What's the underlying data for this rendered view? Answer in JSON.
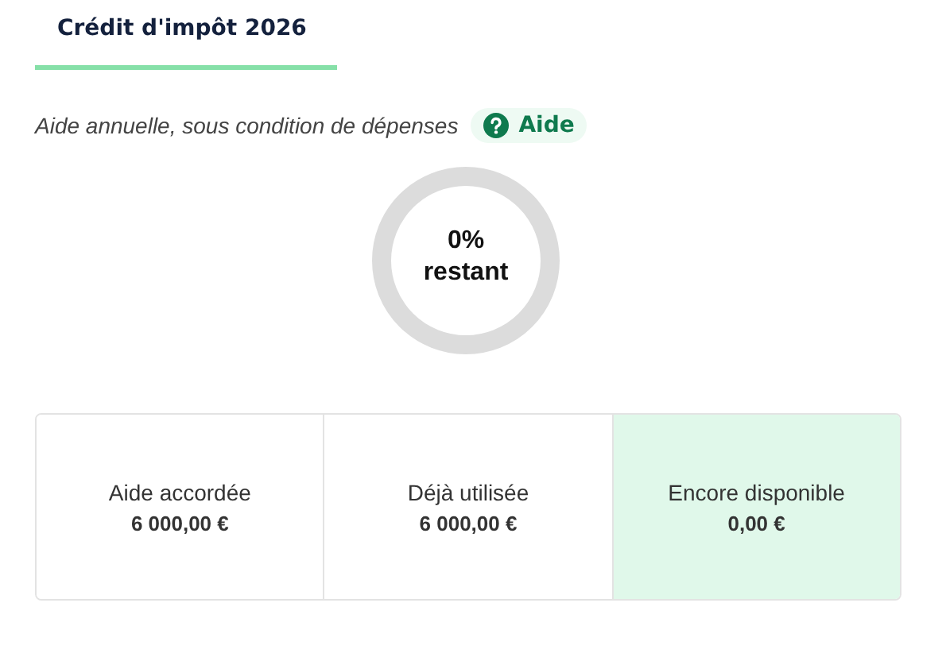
{
  "tabs": [
    {
      "label": "Crédit d'impôt 2026",
      "selected": true
    }
  ],
  "description": "Aide annuelle, sous condition de dépenses",
  "help_button": {
    "label": "Aide"
  },
  "gauge": {
    "value": "0%",
    "caption": "restant"
  },
  "summary": [
    {
      "label": "Aide accordée",
      "amount": "6 000,00 €",
      "highlighted": false
    },
    {
      "label": "Déjà utilisée",
      "amount": "6 000,00 €",
      "highlighted": false
    },
    {
      "label": "Encore disponible",
      "amount": "0,00 €",
      "highlighted": true
    }
  ]
}
